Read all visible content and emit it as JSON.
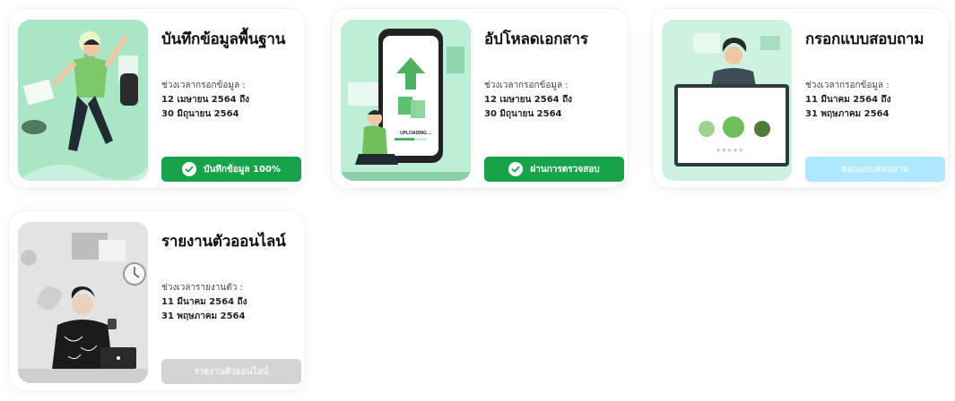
{
  "cards": [
    {
      "title": "บันทึกข้อมูลพื้นฐาน",
      "period_label": "ช่วงเวลากรอกข้อมูล :",
      "period_start": "12 เมษายน 2564 ถึง",
      "period_end": "30 มิถุนายน 2564",
      "button_label": "บันทึกข้อมูล 100%",
      "button_icon": "check-circle-icon",
      "button_color": "#17a34a"
    },
    {
      "title": "อัปโหลดเอกสาร",
      "period_label": "ช่วงเวลากรอกข้อมูล :",
      "period_start": "12 เมษายน 2564 ถึง",
      "period_end": "30 มิถุนายน 2564",
      "button_label": "ผ่านการตรวจสอบ",
      "button_icon": "check-circle-icon",
      "button_color": "#17a34a",
      "phone_text": "UPLOADING ..."
    },
    {
      "title": "กรอกแบบสอบถาม",
      "period_label": "ช่วงเวลากรอกข้อมูล :",
      "period_start": "11 มีนาคม 2564 ถึง",
      "period_end": "31 พฤษภาคม 2564",
      "button_label": "ตอบแบบสอบถาม",
      "button_color": "#aee8fd"
    },
    {
      "title": "รายงานตัวออนไลน์",
      "period_label": "ช่วงเวลารายงานตัว :",
      "period_start": "11 มีนาคม 2564 ถึง",
      "period_end": "31 พฤษภาคม 2564",
      "button_label": "รายงานตัวออนไลน์",
      "button_color": "#d4d4d4"
    }
  ]
}
